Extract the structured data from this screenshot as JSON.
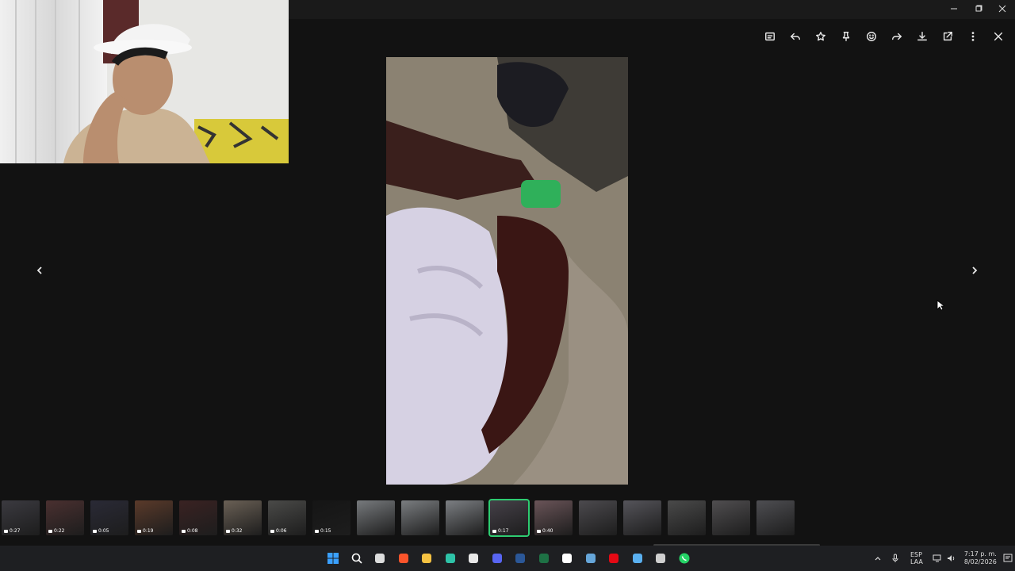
{
  "window": {
    "controls": [
      "minimize",
      "restore",
      "close"
    ]
  },
  "toolbar": {
    "buttons": [
      {
        "name": "caption",
        "icon": "caption-icon"
      },
      {
        "name": "reply",
        "icon": "reply-icon"
      },
      {
        "name": "star",
        "icon": "star-icon"
      },
      {
        "name": "pin",
        "icon": "pin-icon"
      },
      {
        "name": "react",
        "icon": "emoji-icon"
      },
      {
        "name": "forward",
        "icon": "forward-icon"
      },
      {
        "name": "download",
        "icon": "download-icon"
      },
      {
        "name": "open-external",
        "icon": "open-external-icon"
      },
      {
        "name": "more",
        "icon": "more-vertical-icon"
      },
      {
        "name": "close",
        "icon": "close-icon"
      }
    ]
  },
  "thumbnails": [
    {
      "duration": "0:27"
    },
    {
      "duration": "0:22"
    },
    {
      "duration": "0:05"
    },
    {
      "duration": "0:19"
    },
    {
      "duration": "0:08"
    },
    {
      "duration": "0:32"
    },
    {
      "duration": "0:06"
    },
    {
      "duration": "0:15"
    },
    {
      "duration": ""
    },
    {
      "duration": ""
    },
    {
      "duration": ""
    },
    {
      "duration": "0:17",
      "active": true
    },
    {
      "duration": "0:40"
    },
    {
      "duration": ""
    },
    {
      "duration": ""
    },
    {
      "duration": ""
    },
    {
      "duration": ""
    },
    {
      "duration": ""
    }
  ],
  "taskbar": {
    "apps": [
      "windows-start-icon",
      "search-icon",
      "task-view-icon",
      "brave-icon",
      "file-explorer-icon",
      "edge-icon",
      "store-icon",
      "discord-icon",
      "word-icon",
      "excel-icon",
      "tiktok-icon",
      "steam-icon",
      "netflix-icon",
      "photos-icon",
      "settings-icon",
      "whatsapp-icon"
    ],
    "tray": {
      "lang_top": "ESP",
      "lang_bottom": "LAA",
      "time": "7:17 p. m.",
      "date": "8/02/2026"
    }
  },
  "colors": {
    "accent": "#2ecc71",
    "background": "#121212",
    "taskbar": "#1e1f22"
  }
}
